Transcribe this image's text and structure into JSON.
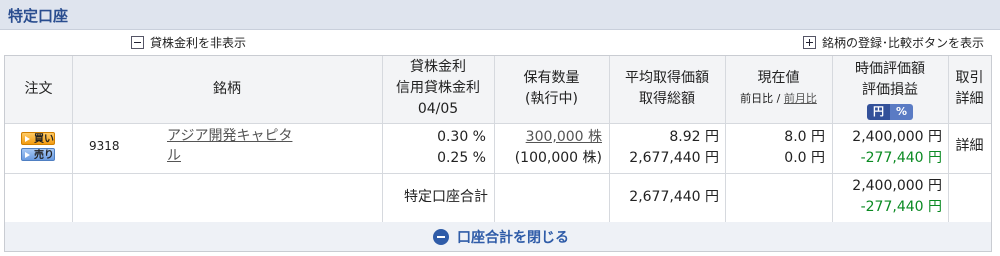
{
  "section": {
    "title": "特定口座"
  },
  "toggles": {
    "hide_lending": "貸株金利を非表示",
    "show_buttons": "銘柄の登録･比較ボタンを表示"
  },
  "header": {
    "order": "注文",
    "brand": "銘柄",
    "rate_line1": "貸株金利",
    "rate_line2": "信用貸株金利",
    "rate_date": "04/05",
    "qty_line1": "保有数量",
    "qty_line2": "(執行中)",
    "avg_line1": "平均取得価額",
    "avg_line2": "取得総額",
    "cur_line1": "現在値",
    "cur_prev_day": "前日比",
    "cur_sep": " / ",
    "cur_prev_month": "前月比",
    "val_line1": "時価評価額",
    "val_line2": "評価損益",
    "val_toggle_yen": "円",
    "val_toggle_pct": "%",
    "detail_line1": "取引",
    "detail_line2": "詳細"
  },
  "rows": [
    {
      "buy_label": "買い",
      "sell_label": "売り",
      "code": "9318",
      "name_line1": "アジア開発キャピタ",
      "name_line2": "ル",
      "rate1": "0.30 %",
      "rate2": "0.25 %",
      "qty": "300,000 株",
      "qty_pending": "(100,000 株)",
      "avg_price": "8.92 円",
      "total_cost": "2,677,440 円",
      "current_price": "8.0 円",
      "change": "0.0 円",
      "market_value": "2,400,000 円",
      "pnl": "-277,440 円",
      "detail": "詳細"
    }
  ],
  "totals": {
    "label": "特定口座合計",
    "total_cost": "2,677,440 円",
    "market_value": "2,400,000 円",
    "pnl": "-277,440 円"
  },
  "footer": {
    "close_label": "口座合計を閉じる"
  },
  "colors": {
    "header_band": "#dfe4ee",
    "title": "#2a4d8f",
    "gain_loss": "#0a8a22",
    "accent": "#2f5ca8"
  }
}
